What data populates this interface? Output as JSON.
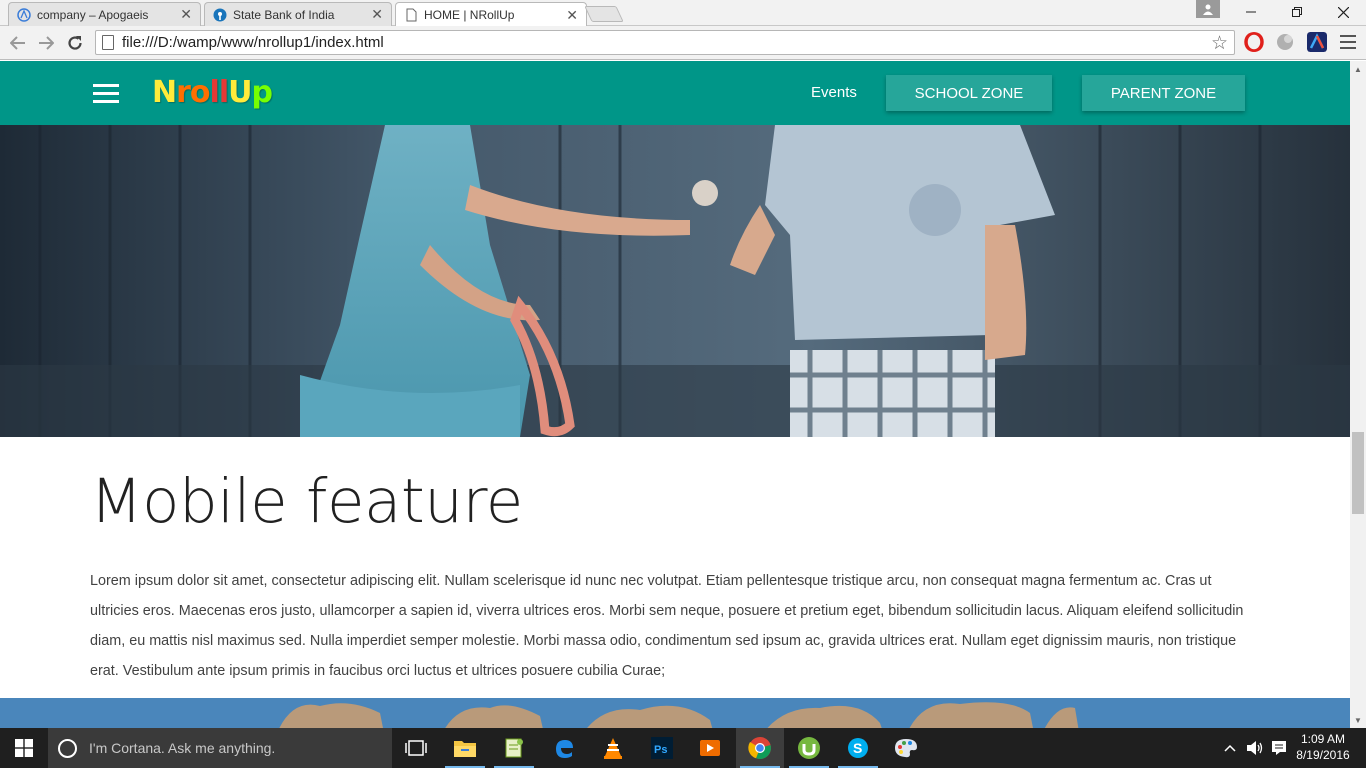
{
  "browser": {
    "tabs": [
      {
        "label": "company – Apogaeis",
        "icon": "apogaeis-icon"
      },
      {
        "label": "State Bank of India",
        "icon": "sbi-icon"
      },
      {
        "label": "HOME | NRollUp",
        "icon": "page-icon",
        "active": true
      }
    ],
    "url": "file:///D:/wamp/www/nrollup1/index.html"
  },
  "site": {
    "brand_letters": [
      "N",
      "r",
      "o",
      "ll",
      "U",
      "p"
    ],
    "nav": {
      "events": "Events",
      "school_zone": "SCHOOL ZONE",
      "parent_zone": "PARENT ZONE"
    },
    "section": {
      "title": "Mobile feature",
      "body": "Lorem ipsum dolor sit amet, consectetur adipiscing elit. Nullam scelerisque id nunc nec volutpat. Etiam pellentesque tristique arcu, non consequat magna fermentum ac. Cras ut ultricies eros. Maecenas eros justo, ullamcorper a sapien id, viverra ultrices eros. Morbi sem neque, posuere et pretium eget, bibendum sollicitudin lacus. Aliquam eleifend sollicitudin diam, eu mattis nisl maximus sed. Nulla imperdiet semper molestie. Morbi massa odio, condimentum sed ipsum ac, gravida ultrices erat. Nullam eget dignissim mauris, non tristique erat. Vestibulum ante ipsum primis in faucibus orci luctus et ultrices posuere cubilia Curae;"
    },
    "colors": {
      "navbar": "#009688",
      "zone_button": "#26a69a"
    }
  },
  "taskbar": {
    "cortana_placeholder": "I'm Cortana. Ask me anything.",
    "time": "1:09 AM",
    "date": "8/19/2016"
  }
}
